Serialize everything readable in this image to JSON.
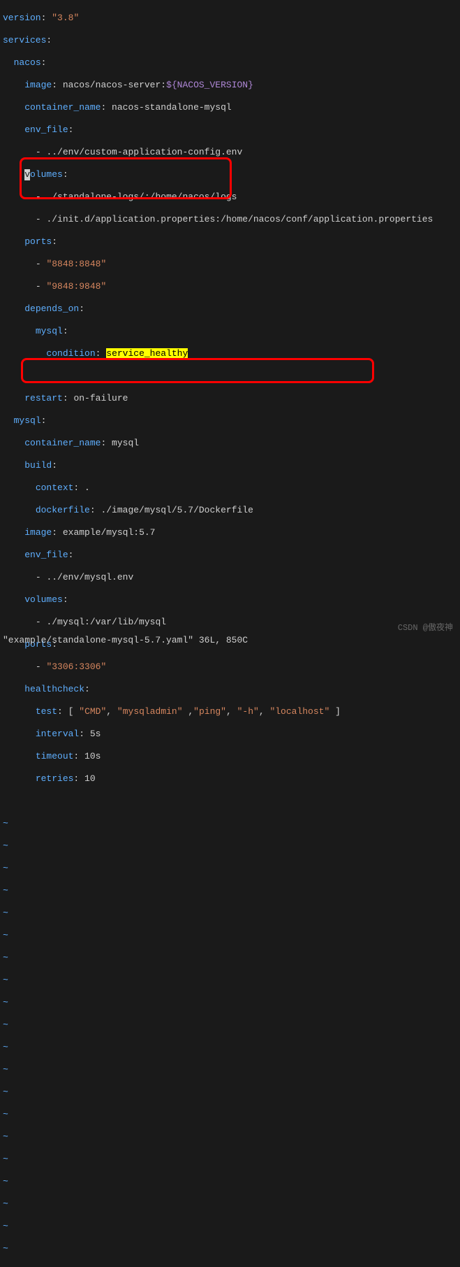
{
  "yaml": {
    "version_key": "version",
    "version_val": "\"3.8\"",
    "services_key": "services",
    "nacos_key": "nacos",
    "image_key": "image",
    "nacos_image_prefix": " nacos/nacos-server:",
    "nacos_image_var": "${NACOS_VERSION}",
    "container_name_key": "container_name",
    "nacos_container_name": " nacos-standalone-mysql",
    "env_file_key": "env_file",
    "nacos_env_file": "../env/custom-application-config.env",
    "volumes_key": "volumes",
    "volumes_v_char": "v",
    "volumes_rest": "olumes",
    "nacos_vol1": "./standalone-logs/:/home/nacos/logs",
    "nacos_vol2": "./init.d/application.properties:/home/nacos/conf/application.properties",
    "ports_key": "ports",
    "nacos_port1": "\"8848:8848\"",
    "nacos_port2": "\"9848:9848\"",
    "depends_on_key": "depends_on",
    "mysql_dep_key": "mysql",
    "condition_key": "condition",
    "service_healthy": "service_healthy",
    "restart_key": "restart",
    "restart_val": " on-failure",
    "mysql_key": "mysql",
    "mysql_container_name": " mysql",
    "build_key": "build",
    "context_key": "context",
    "context_val": " .",
    "dockerfile_key": "dockerfile",
    "dockerfile_val": " ./image/mysql/5.7/Dockerfile",
    "mysql_image_key": "image",
    "mysql_image_val": " example/mysql:5.7",
    "mysql_env_file": "../env/mysql.env",
    "mysql_vol1": "./mysql:/var/lib/mysql",
    "mysql_port1": "\"3306:3306\"",
    "healthcheck_key": "healthcheck",
    "test_key": "test",
    "test_cmd": "\"CMD\"",
    "test_mysqladmin": "\"mysqladmin\"",
    "test_ping": "\"ping\"",
    "test_h": "\"-h\"",
    "test_localhost": "\"localhost\"",
    "interval_key": "interval",
    "interval_val": " 5s",
    "timeout_key": "timeout",
    "timeout_val": " 10s",
    "retries_key": "retries",
    "retries_val": " 10"
  },
  "status": "\"example/standalone-mysql-5.7.yaml\" 36L, 850C",
  "watermark": "CSDN @傲夜神",
  "tilde": "~"
}
